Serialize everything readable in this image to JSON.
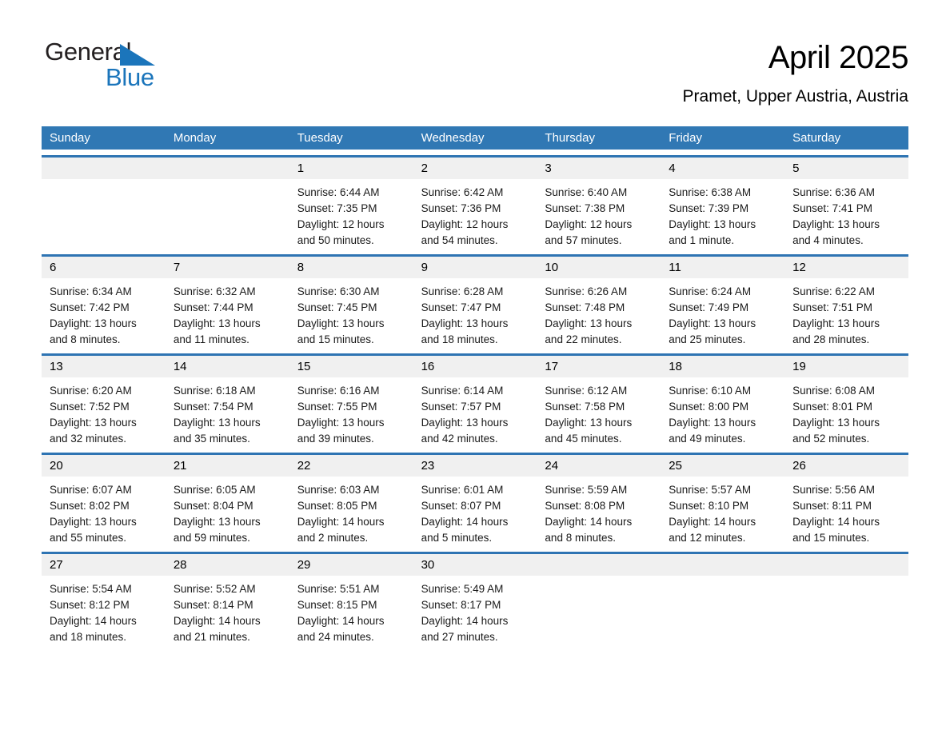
{
  "logo": {
    "line1": "General",
    "line2": "Blue",
    "triangle_color": "#1b75bb"
  },
  "header": {
    "title": "April 2025",
    "subtitle": "Pramet, Upper Austria, Austria"
  },
  "colors": {
    "header_blue": "#3078b4",
    "row_rule_blue": "#2e74b3",
    "daynum_band": "#f0f0f0"
  },
  "weekdays": [
    "Sunday",
    "Monday",
    "Tuesday",
    "Wednesday",
    "Thursday",
    "Friday",
    "Saturday"
  ],
  "weeks": [
    [
      {
        "day": "",
        "sunrise": "",
        "sunset": "",
        "daylight": ""
      },
      {
        "day": "",
        "sunrise": "",
        "sunset": "",
        "daylight": ""
      },
      {
        "day": "1",
        "sunrise": "Sunrise: 6:44 AM",
        "sunset": "Sunset: 7:35 PM",
        "daylight": "Daylight: 12 hours and 50 minutes."
      },
      {
        "day": "2",
        "sunrise": "Sunrise: 6:42 AM",
        "sunset": "Sunset: 7:36 PM",
        "daylight": "Daylight: 12 hours and 54 minutes."
      },
      {
        "day": "3",
        "sunrise": "Sunrise: 6:40 AM",
        "sunset": "Sunset: 7:38 PM",
        "daylight": "Daylight: 12 hours and 57 minutes."
      },
      {
        "day": "4",
        "sunrise": "Sunrise: 6:38 AM",
        "sunset": "Sunset: 7:39 PM",
        "daylight": "Daylight: 13 hours and 1 minute."
      },
      {
        "day": "5",
        "sunrise": "Sunrise: 6:36 AM",
        "sunset": "Sunset: 7:41 PM",
        "daylight": "Daylight: 13 hours and 4 minutes."
      }
    ],
    [
      {
        "day": "6",
        "sunrise": "Sunrise: 6:34 AM",
        "sunset": "Sunset: 7:42 PM",
        "daylight": "Daylight: 13 hours and 8 minutes."
      },
      {
        "day": "7",
        "sunrise": "Sunrise: 6:32 AM",
        "sunset": "Sunset: 7:44 PM",
        "daylight": "Daylight: 13 hours and 11 minutes."
      },
      {
        "day": "8",
        "sunrise": "Sunrise: 6:30 AM",
        "sunset": "Sunset: 7:45 PM",
        "daylight": "Daylight: 13 hours and 15 minutes."
      },
      {
        "day": "9",
        "sunrise": "Sunrise: 6:28 AM",
        "sunset": "Sunset: 7:47 PM",
        "daylight": "Daylight: 13 hours and 18 minutes."
      },
      {
        "day": "10",
        "sunrise": "Sunrise: 6:26 AM",
        "sunset": "Sunset: 7:48 PM",
        "daylight": "Daylight: 13 hours and 22 minutes."
      },
      {
        "day": "11",
        "sunrise": "Sunrise: 6:24 AM",
        "sunset": "Sunset: 7:49 PM",
        "daylight": "Daylight: 13 hours and 25 minutes."
      },
      {
        "day": "12",
        "sunrise": "Sunrise: 6:22 AM",
        "sunset": "Sunset: 7:51 PM",
        "daylight": "Daylight: 13 hours and 28 minutes."
      }
    ],
    [
      {
        "day": "13",
        "sunrise": "Sunrise: 6:20 AM",
        "sunset": "Sunset: 7:52 PM",
        "daylight": "Daylight: 13 hours and 32 minutes."
      },
      {
        "day": "14",
        "sunrise": "Sunrise: 6:18 AM",
        "sunset": "Sunset: 7:54 PM",
        "daylight": "Daylight: 13 hours and 35 minutes."
      },
      {
        "day": "15",
        "sunrise": "Sunrise: 6:16 AM",
        "sunset": "Sunset: 7:55 PM",
        "daylight": "Daylight: 13 hours and 39 minutes."
      },
      {
        "day": "16",
        "sunrise": "Sunrise: 6:14 AM",
        "sunset": "Sunset: 7:57 PM",
        "daylight": "Daylight: 13 hours and 42 minutes."
      },
      {
        "day": "17",
        "sunrise": "Sunrise: 6:12 AM",
        "sunset": "Sunset: 7:58 PM",
        "daylight": "Daylight: 13 hours and 45 minutes."
      },
      {
        "day": "18",
        "sunrise": "Sunrise: 6:10 AM",
        "sunset": "Sunset: 8:00 PM",
        "daylight": "Daylight: 13 hours and 49 minutes."
      },
      {
        "day": "19",
        "sunrise": "Sunrise: 6:08 AM",
        "sunset": "Sunset: 8:01 PM",
        "daylight": "Daylight: 13 hours and 52 minutes."
      }
    ],
    [
      {
        "day": "20",
        "sunrise": "Sunrise: 6:07 AM",
        "sunset": "Sunset: 8:02 PM",
        "daylight": "Daylight: 13 hours and 55 minutes."
      },
      {
        "day": "21",
        "sunrise": "Sunrise: 6:05 AM",
        "sunset": "Sunset: 8:04 PM",
        "daylight": "Daylight: 13 hours and 59 minutes."
      },
      {
        "day": "22",
        "sunrise": "Sunrise: 6:03 AM",
        "sunset": "Sunset: 8:05 PM",
        "daylight": "Daylight: 14 hours and 2 minutes."
      },
      {
        "day": "23",
        "sunrise": "Sunrise: 6:01 AM",
        "sunset": "Sunset: 8:07 PM",
        "daylight": "Daylight: 14 hours and 5 minutes."
      },
      {
        "day": "24",
        "sunrise": "Sunrise: 5:59 AM",
        "sunset": "Sunset: 8:08 PM",
        "daylight": "Daylight: 14 hours and 8 minutes."
      },
      {
        "day": "25",
        "sunrise": "Sunrise: 5:57 AM",
        "sunset": "Sunset: 8:10 PM",
        "daylight": "Daylight: 14 hours and 12 minutes."
      },
      {
        "day": "26",
        "sunrise": "Sunrise: 5:56 AM",
        "sunset": "Sunset: 8:11 PM",
        "daylight": "Daylight: 14 hours and 15 minutes."
      }
    ],
    [
      {
        "day": "27",
        "sunrise": "Sunrise: 5:54 AM",
        "sunset": "Sunset: 8:12 PM",
        "daylight": "Daylight: 14 hours and 18 minutes."
      },
      {
        "day": "28",
        "sunrise": "Sunrise: 5:52 AM",
        "sunset": "Sunset: 8:14 PM",
        "daylight": "Daylight: 14 hours and 21 minutes."
      },
      {
        "day": "29",
        "sunrise": "Sunrise: 5:51 AM",
        "sunset": "Sunset: 8:15 PM",
        "daylight": "Daylight: 14 hours and 24 minutes."
      },
      {
        "day": "30",
        "sunrise": "Sunrise: 5:49 AM",
        "sunset": "Sunset: 8:17 PM",
        "daylight": "Daylight: 14 hours and 27 minutes."
      },
      {
        "day": "",
        "sunrise": "",
        "sunset": "",
        "daylight": ""
      },
      {
        "day": "",
        "sunrise": "",
        "sunset": "",
        "daylight": ""
      },
      {
        "day": "",
        "sunrise": "",
        "sunset": "",
        "daylight": ""
      }
    ]
  ]
}
